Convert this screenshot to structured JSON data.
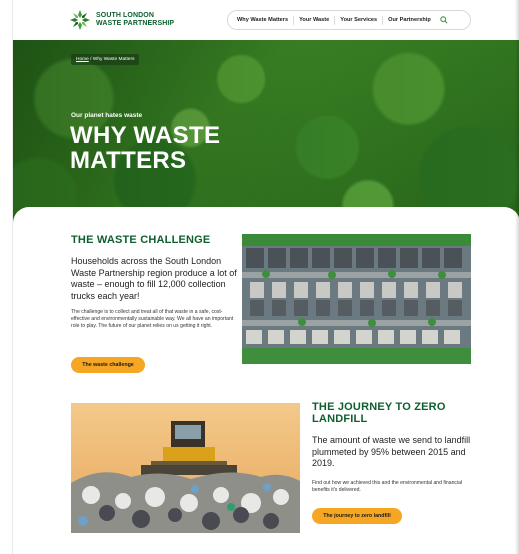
{
  "brand": {
    "name_line1": "SOUTH LONDON",
    "name_line2": "WASTE PARTNERSHIP",
    "primary_green": "#0d5f2e",
    "accent_orange": "#f5a623"
  },
  "nav": {
    "items": [
      {
        "label": "Why Waste Matters"
      },
      {
        "label": "Your Waste"
      },
      {
        "label": "Your Services"
      },
      {
        "label": "Our Partnership"
      }
    ],
    "search_icon": "search-icon"
  },
  "hero": {
    "breadcrumb_home": "Home",
    "breadcrumb_rest": " / Why Waste Matters",
    "kicker": "Our planet hates waste",
    "title": "WHY WASTE MATTERS"
  },
  "section1": {
    "title": "THE WASTE CHALLENGE",
    "lead": "Households across the South London Waste Partnership region produce a lot of waste – enough to fill 12,000 collection trucks each year!",
    "body": "The challenge is to collect and treat all of that waste in a safe, cost-effective and environmentally sustainable way. We all have an important role to play. The future of our planet relies on us getting it right.",
    "button": "The waste challenge"
  },
  "section2": {
    "title": "THE JOURNEY TO ZERO LANDFILL",
    "lead": "The amount of waste we send to landfill plummeted by 95% between 2015 and 2019.",
    "body": "Find out how we achieved this and the environmental and financial benefits it's delivered.",
    "button": "The journey to zero landfill"
  }
}
